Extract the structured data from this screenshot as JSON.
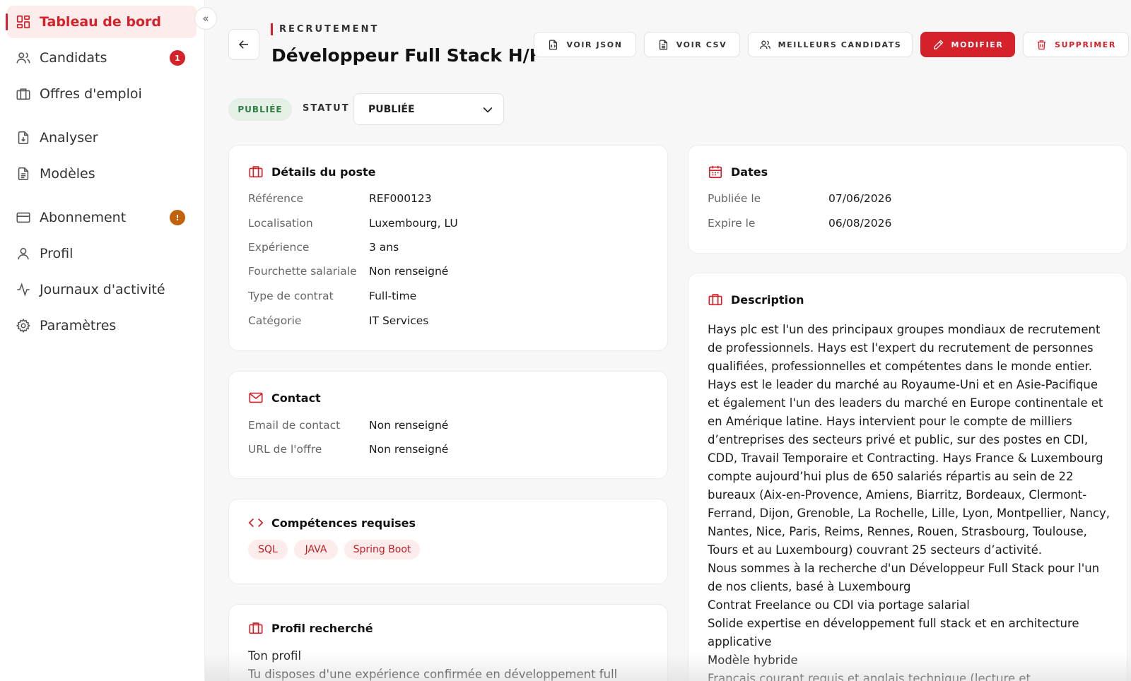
{
  "sidebar": {
    "items": [
      {
        "label": "Tableau de bord",
        "icon": "dashboard-icon"
      },
      {
        "label": "Candidats",
        "icon": "users-icon",
        "badge": "1"
      },
      {
        "label": "Offres d'emploi",
        "icon": "briefcase-icon"
      },
      {
        "label": "Analyser",
        "icon": "file-download-icon"
      },
      {
        "label": "Modèles",
        "icon": "file-text-icon"
      },
      {
        "label": "Abonnement",
        "icon": "credit-card-icon",
        "badge": "!"
      },
      {
        "label": "Profil",
        "icon": "user-icon"
      },
      {
        "label": "Journaux d'activité",
        "icon": "activity-icon"
      },
      {
        "label": "Paramètres",
        "icon": "gear-icon"
      }
    ],
    "collapse_icon": "«"
  },
  "header": {
    "eyebrow": "RECRUTEMENT",
    "title": "Développeur Full Stack H/F"
  },
  "toolbar": {
    "json": "VOIR JSON",
    "csv": "VOIR CSV",
    "best": "MEILLEURS CANDIDATS",
    "edit": "MODIFIER",
    "delete": "SUPPRIMER"
  },
  "status": {
    "pill": "PUBLIÉE",
    "label": "STATUT",
    "selected": "PUBLIÉE"
  },
  "details": {
    "title": "Détails du poste",
    "rows": [
      {
        "k": "Référence",
        "v": "REF000123"
      },
      {
        "k": "Localisation",
        "v": "Luxembourg, LU"
      },
      {
        "k": "Expérience",
        "v": "3 ans"
      },
      {
        "k": "Fourchette salariale",
        "v": "Non renseigné"
      },
      {
        "k": "Type de contrat",
        "v": "Full-time"
      },
      {
        "k": "Catégorie",
        "v": "IT Services"
      }
    ]
  },
  "contact": {
    "title": "Contact",
    "rows": [
      {
        "k": "Email de contact",
        "v": "Non renseigné"
      },
      {
        "k": "URL de l'offre",
        "v": "Non renseigné"
      }
    ]
  },
  "skills": {
    "title": "Compétences requises",
    "tags": [
      "SQL",
      "JAVA",
      "Spring Boot"
    ]
  },
  "profile": {
    "title": "Profil recherché",
    "lines": [
      "Ton profil",
      "Tu disposes d'une expérience confirmée en développement full stack"
    ]
  },
  "dates": {
    "title": "Dates",
    "rows": [
      {
        "k": "Publiée le",
        "v": "07/06/2026"
      },
      {
        "k": "Expire le",
        "v": "06/08/2026"
      }
    ]
  },
  "description": {
    "title": "Description",
    "paragraphs": [
      "Hays plc est l'un des principaux groupes mondiaux de recrutement de professionnels. Hays est l'expert du recrutement de personnes qualifiées, professionnelles et compétentes dans le monde entier.",
      "Hays est le leader du marché au Royaume-Uni et en Asie-Pacifique et également l'un des leaders du marché en Europe continentale et en Amérique latine. Hays intervient pour le compte de milliers d’entreprises des secteurs privé et public, sur des postes en CDI, CDD, Travail Temporaire et Contracting. Hays France & Luxembourg compte aujourd’hui plus de 650 salariés répartis au sein de 22 bureaux (Aix-en-Provence, Amiens, Biarritz, Bordeaux, Clermont-Ferrand, Dijon, Grenoble, La Rochelle, Lille, Lyon, Montpellier, Nancy, Nantes, Nice, Paris, Reims, Rennes, Rouen, Strasbourg, Toulouse, Tours et au Luxembourg) couvrant 25 secteurs d’activité.",
      "Nous sommes à la recherche d'un Développeur Full Stack pour l'un de nos clients, basé à Luxembourg",
      "Contrat Freelance ou CDI via portage salarial",
      "Solide expertise en développement full stack et en architecture applicative",
      "Modèle hybride",
      "Français courant requis et anglais technique (lecture et"
    ]
  },
  "colors": {
    "accent": "#d4212a",
    "active_bg": "#fdecec",
    "success_bg": "#e4efe6",
    "success_text": "#2e7d43",
    "warning": "#c2620a"
  }
}
